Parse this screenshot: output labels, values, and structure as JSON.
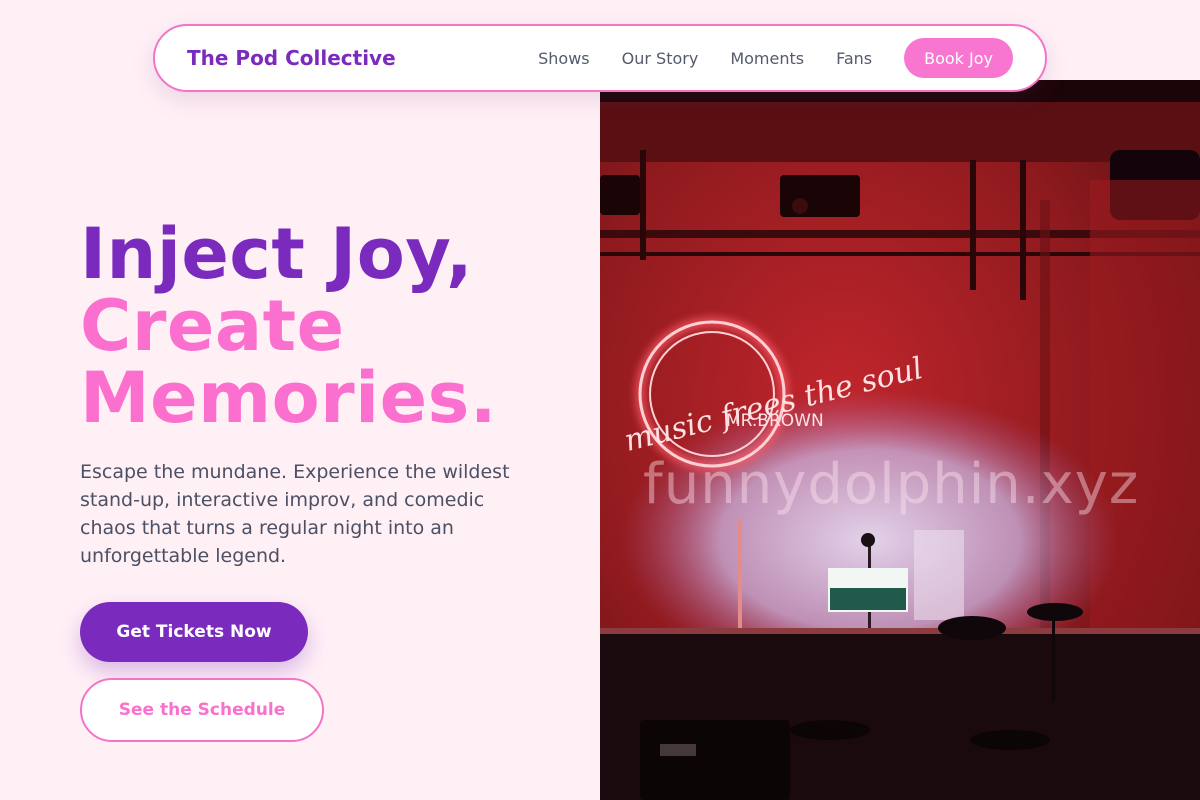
{
  "nav": {
    "brand": "The Pod Collective",
    "links": [
      {
        "label": "Shows"
      },
      {
        "label": "Our Story"
      },
      {
        "label": "Moments"
      },
      {
        "label": "Fans"
      }
    ],
    "cta_label": "Book Joy"
  },
  "hero": {
    "title_line1": "Inject Joy,",
    "title_line2": "Create",
    "title_line3": "Memories.",
    "description": "Escape the mundane. Experience the wildest stand-up, interactive improv, and comedic chaos that turns a regular night into an unforgettable legend.",
    "primary_button": "Get Tickets Now",
    "secondary_button": "See the Schedule"
  },
  "image": {
    "description": "comedy club stage with red neon sign",
    "neon_script": "music frees the soul",
    "neon_name": "MR.BROWN",
    "watermark": "funnydolphin.xyz"
  },
  "colors": {
    "background": "#fff0f6",
    "brand_purple": "#7a2bbd",
    "accent_pink": "#fb6fcf",
    "text_muted": "#4c5064"
  }
}
